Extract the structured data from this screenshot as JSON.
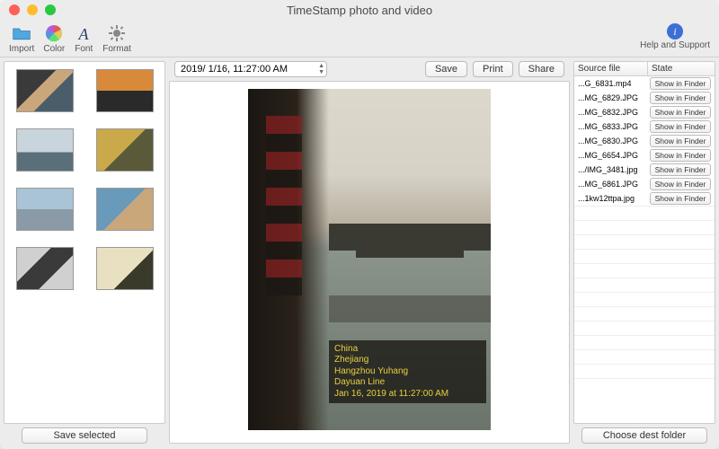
{
  "window": {
    "title": "TimeStamp photo and video"
  },
  "toolbar": {
    "import_label": "Import",
    "color_label": "Color",
    "font_label": "Font",
    "format_label": "Format",
    "help_label": "Help and Support"
  },
  "left": {
    "save_selected_label": "Save selected"
  },
  "center": {
    "date_value": "2019/  1/16, 11:27:00 AM",
    "save_label": "Save",
    "print_label": "Print",
    "share_label": "Share",
    "stamp": {
      "line1": "China",
      "line2": "Zhejiang",
      "line3": "Hangzhou Yuhang",
      "line4": "Dayuan Line",
      "line5": "Jan 16, 2019 at 11:27:00 AM"
    }
  },
  "right": {
    "col1_header": "Source file",
    "col2_header": "State",
    "show_in_finder_label": "Show in Finder",
    "rows": [
      {
        "name": "...G_6831.mp4"
      },
      {
        "name": "...MG_6829.JPG"
      },
      {
        "name": "...MG_6832.JPG"
      },
      {
        "name": "...MG_6833.JPG"
      },
      {
        "name": "...MG_6830.JPG"
      },
      {
        "name": "...MG_6654.JPG"
      },
      {
        "name": ".../IMG_3481.jpg"
      },
      {
        "name": "...MG_6861.JPG"
      },
      {
        "name": "...1kw12ttpa.jpg"
      }
    ],
    "choose_dest_label": "Choose dest folder"
  }
}
